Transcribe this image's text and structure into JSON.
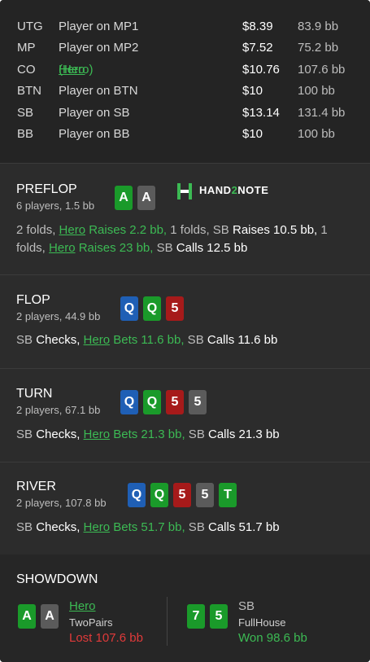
{
  "seats": [
    {
      "pos": "UTG",
      "name": "Player on MP1",
      "stack": "$8.39",
      "bb": "83.9 bb",
      "hero": false
    },
    {
      "pos": "MP",
      "name": "Player on MP2",
      "stack": "$7.52",
      "bb": "75.2 bb",
      "hero": false
    },
    {
      "pos": "CO",
      "name": "Hero",
      "name_suffix": " (Hero)",
      "stack": "$10.76",
      "bb": "107.6 bb",
      "hero": true
    },
    {
      "pos": "BTN",
      "name": "Player on BTN",
      "stack": "$10",
      "bb": "100 bb",
      "hero": false
    },
    {
      "pos": "SB",
      "name": "Player on SB",
      "stack": "$13.14",
      "bb": "131.4 bb",
      "hero": false
    },
    {
      "pos": "BB",
      "name": "Player on BB",
      "stack": "$10",
      "bb": "100 bb",
      "hero": false
    }
  ],
  "logo": {
    "part1": "HAND",
    "part2": "2",
    "part3": "NOTE"
  },
  "preflop": {
    "title": "PREFLOP",
    "sub": "6 players, 1.5 bb",
    "cards": [
      {
        "rank": "A",
        "suit": "c"
      },
      {
        "rank": "A",
        "suit": "s"
      }
    ],
    "line1": {
      "a": "2 folds, ",
      "hero": "Hero",
      "b": " Raises 2.2 bb,",
      "c": " 1 folds, SB ",
      "d": "Raises 10.5 bb,",
      "e": " 1"
    },
    "line2": {
      "a": "folds, ",
      "hero": "Hero",
      "b": " Raises 23 bb,",
      "c": " SB ",
      "d": "Calls 12.5 bb"
    }
  },
  "flop": {
    "title": "FLOP",
    "sub": "2 players, 44.9 bb",
    "cards": [
      {
        "rank": "Q",
        "suit": "d"
      },
      {
        "rank": "Q",
        "suit": "c"
      },
      {
        "rank": "5",
        "suit": "h"
      }
    ],
    "actions": {
      "a": "SB ",
      "b": "Checks, ",
      "hero": "Hero",
      "c": " Bets 11.6 bb,",
      "d": " SB ",
      "e": "Calls 11.6 bb"
    }
  },
  "turn": {
    "title": "TURN",
    "sub": "2 players, 67.1 bb",
    "cards": [
      {
        "rank": "Q",
        "suit": "d"
      },
      {
        "rank": "Q",
        "suit": "c"
      },
      {
        "rank": "5",
        "suit": "h"
      },
      {
        "rank": "5",
        "suit": "s"
      }
    ],
    "actions": {
      "a": "SB ",
      "b": "Checks, ",
      "hero": "Hero",
      "c": " Bets 21.3 bb,",
      "d": " SB ",
      "e": "Calls 21.3 bb"
    }
  },
  "river": {
    "title": "RIVER",
    "sub": "2 players, 107.8 bb",
    "cards": [
      {
        "rank": "Q",
        "suit": "d"
      },
      {
        "rank": "Q",
        "suit": "c"
      },
      {
        "rank": "5",
        "suit": "h"
      },
      {
        "rank": "5",
        "suit": "s"
      },
      {
        "rank": "T",
        "suit": "c"
      }
    ],
    "actions": {
      "a": "SB ",
      "b": "Checks, ",
      "hero": "Hero",
      "c": " Bets 51.7 bb,",
      "d": " SB ",
      "e": "Calls 51.7 bb"
    }
  },
  "showdown": {
    "title": "SHOWDOWN",
    "hero": {
      "name": "Hero",
      "hand": "TwoPairs",
      "result": "Lost 107.6 bb",
      "cards": [
        {
          "rank": "A",
          "suit": "c"
        },
        {
          "rank": "A",
          "suit": "s"
        }
      ]
    },
    "villain": {
      "name": "SB",
      "hand": "FullHouse",
      "result": "Won 98.6 bb",
      "cards": [
        {
          "rank": "7",
          "suit": "c"
        },
        {
          "rank": "5",
          "suit": "c"
        }
      ]
    }
  },
  "colors": {
    "hero": "#3cba54",
    "lost": "#e03a3a",
    "won": "#3cba54",
    "spade": "#5b5b5b",
    "club": "#1a9a2a",
    "diamond": "#1f5fb5",
    "heart": "#a61a1a"
  }
}
